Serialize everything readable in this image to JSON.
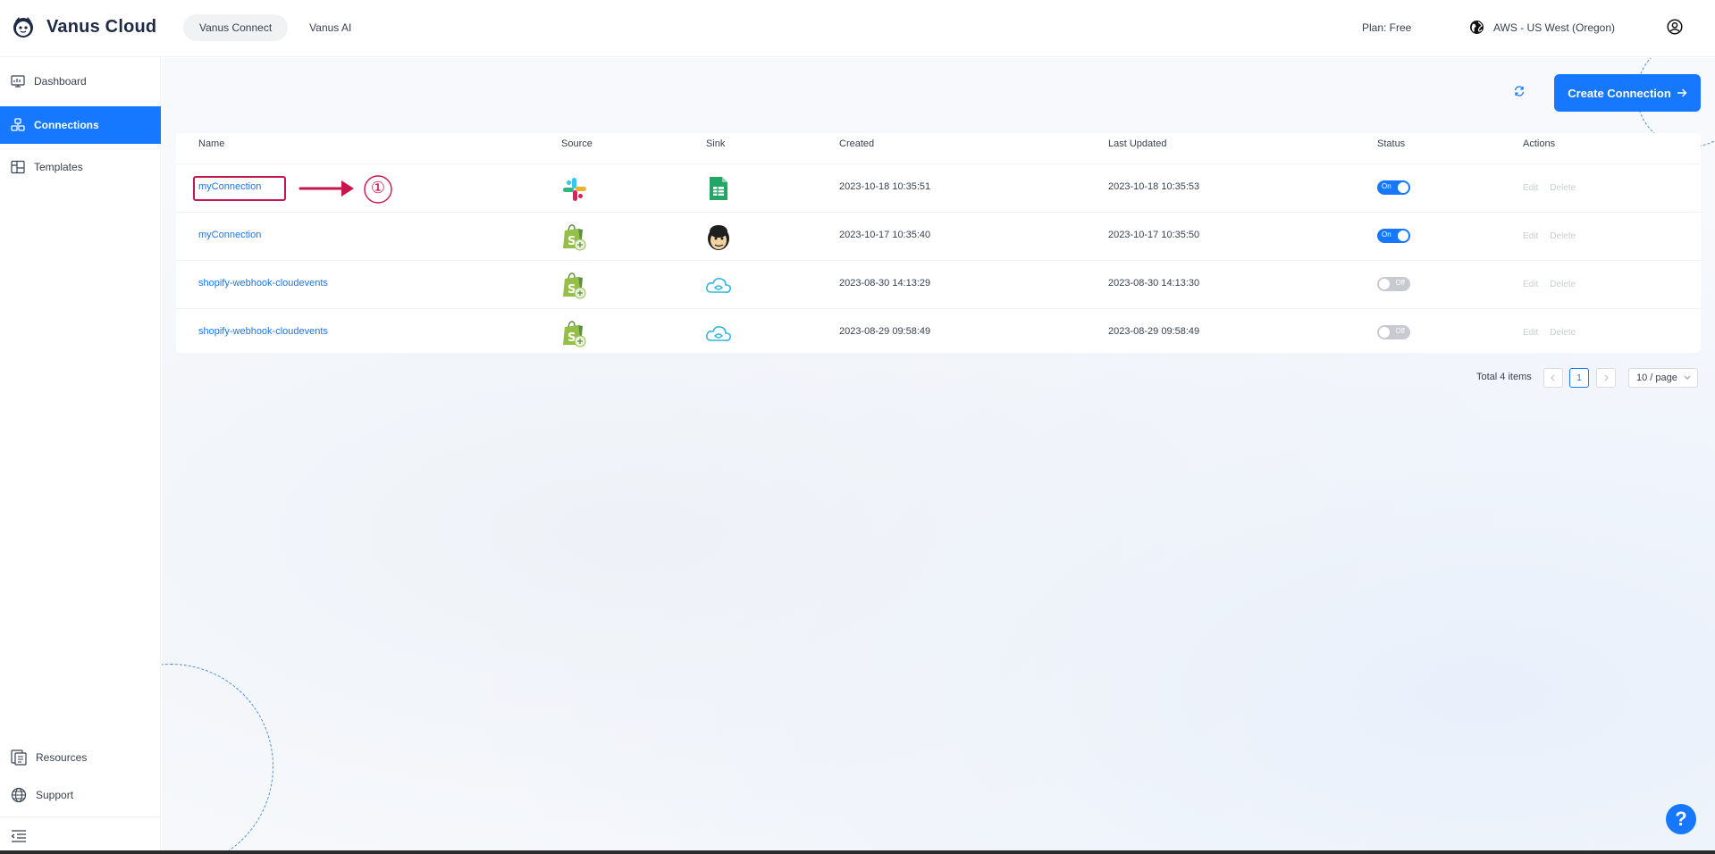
{
  "app": {
    "name": "Vanus Cloud"
  },
  "top_tabs": [
    {
      "label": "Vanus Connect",
      "active": true
    },
    {
      "label": "Vanus AI",
      "active": false
    }
  ],
  "header": {
    "plan": "Plan: Free",
    "region": "AWS - US West (Oregon)"
  },
  "sidebar": {
    "items": [
      {
        "label": "Dashboard",
        "icon": "dashboard-icon",
        "active": false
      },
      {
        "label": "Connections",
        "icon": "connections-icon",
        "active": true
      },
      {
        "label": "Templates",
        "icon": "templates-icon",
        "active": false
      }
    ],
    "bottom_items": [
      {
        "label": "Resources",
        "icon": "resources-icon"
      },
      {
        "label": "Support",
        "icon": "globe-icon"
      }
    ]
  },
  "toolbar": {
    "create_label": "Create Connection"
  },
  "table": {
    "columns": [
      "Name",
      "Source",
      "Sink",
      "Created",
      "Last Updated",
      "Status",
      "Actions"
    ],
    "rows": [
      {
        "name": "myConnection",
        "source": "slack-icon",
        "sink": "google-sheets-icon",
        "created": "2023-10-18 10:35:51",
        "updated": "2023-10-18 10:35:53",
        "status": "On",
        "status_on": true
      },
      {
        "name": "myConnection",
        "source": "shopify-icon",
        "sink": "mailchimp-icon",
        "created": "2023-10-17 10:35:40",
        "updated": "2023-10-17 10:35:50",
        "status": "On",
        "status_on": true
      },
      {
        "name": "shopify-webhook-cloudevents",
        "source": "shopify-icon",
        "sink": "cloudevents-icon",
        "created": "2023-08-30 14:13:29",
        "updated": "2023-08-30 14:13:30",
        "status": "Off",
        "status_on": false
      },
      {
        "name": "shopify-webhook-cloudevents",
        "source": "shopify-icon",
        "sink": "cloudevents-icon",
        "created": "2023-08-29 09:58:49",
        "updated": "2023-08-29 09:58:49",
        "status": "Off",
        "status_on": false
      }
    ],
    "actions": {
      "edit": "Edit",
      "delete": "Delete"
    }
  },
  "annotation": {
    "marker": "①"
  },
  "pagination": {
    "total": "Total 4 items",
    "current_page": "1",
    "page_size": "10 / page"
  },
  "help": {
    "label": "?"
  },
  "colors": {
    "accent": "#1677ff",
    "annotation": "#c8154d"
  }
}
